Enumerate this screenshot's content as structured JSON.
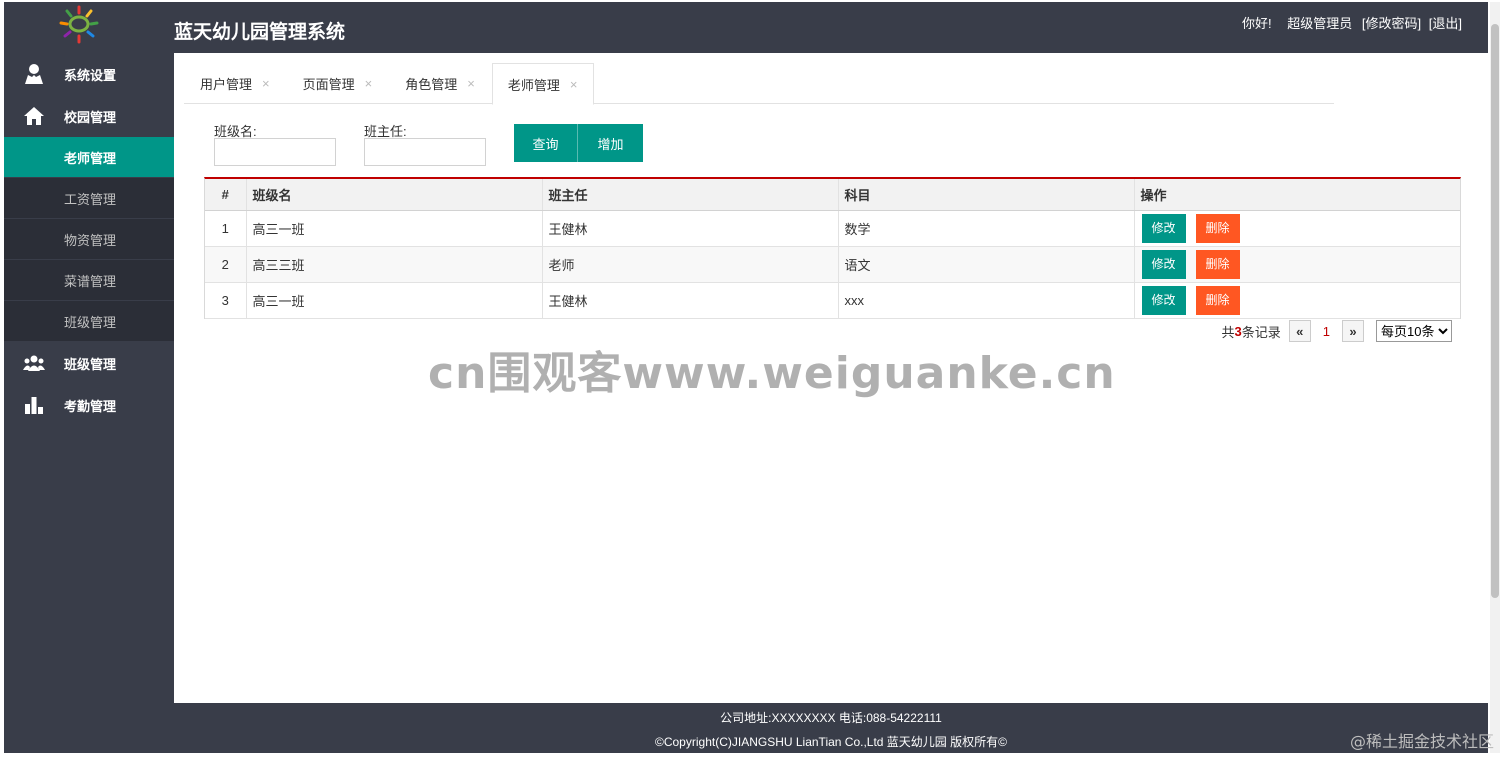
{
  "header": {
    "title": "蓝天幼儿园管理系统",
    "greeting": "你好!",
    "username": "超级管理员",
    "change_password": "[修改密码]",
    "logout": "[退出]"
  },
  "sidebar": {
    "groups": [
      {
        "label": "系统设置",
        "icon": "user-icon"
      },
      {
        "label": "校园管理",
        "icon": "home-icon"
      }
    ],
    "children": [
      {
        "label": "老师管理",
        "active": true
      },
      {
        "label": "工资管理"
      },
      {
        "label": "物资管理"
      },
      {
        "label": "菜谱管理"
      },
      {
        "label": "班级管理"
      }
    ],
    "groups_after": [
      {
        "label": "班级管理",
        "icon": "users-icon"
      },
      {
        "label": "考勤管理",
        "icon": "bar-chart-icon"
      }
    ]
  },
  "tabs": [
    {
      "label": "用户管理"
    },
    {
      "label": "页面管理"
    },
    {
      "label": "角色管理"
    },
    {
      "label": "老师管理",
      "active": true
    }
  ],
  "tab_close": "×",
  "search": {
    "class_label": "班级名:",
    "class_value": "",
    "teacher_label": "班主任:",
    "teacher_value": "",
    "query_button": "查询",
    "add_button": "增加"
  },
  "table": {
    "headers": [
      "#",
      "班级名",
      "班主任",
      "科目",
      "操作"
    ],
    "rows": [
      [
        "1",
        "高三一班",
        "王健林",
        "数学"
      ],
      [
        "2",
        "高三三班",
        "老师",
        "语文"
      ],
      [
        "3",
        "高三一班",
        "王健林",
        "xxx"
      ]
    ],
    "edit_label": "修改",
    "delete_label": "删除"
  },
  "pager": {
    "prefix": "共",
    "count": "3",
    "suffix": "条记录",
    "prev": "«",
    "current": "1",
    "next": "»",
    "page_size": "每页10条"
  },
  "watermark": "cn围观客www.weiguanke.cn",
  "footer": {
    "address": "公司地址:XXXXXXXX 电话:088-54222111",
    "copyright": "©Copyright(C)JIANGSHU LianTian Co.,Ltd 蓝天幼儿园 版权所有©"
  },
  "corner_mark": "@稀土掘金技术社区",
  "colors": {
    "header_bg": "#393d49",
    "accent": "#009688",
    "danger": "#ff5722",
    "table_top_border": "#c00000"
  }
}
